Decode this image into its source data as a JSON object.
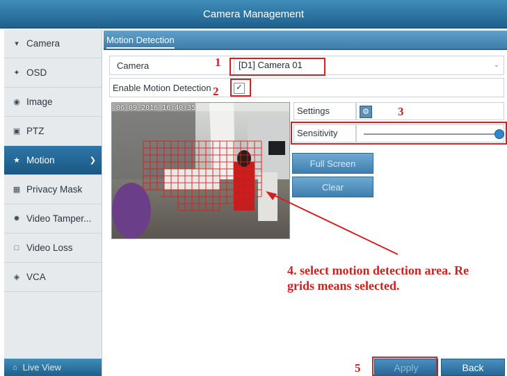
{
  "window": {
    "title": "Camera Management"
  },
  "sidebar": {
    "items": [
      {
        "label": "Camera",
        "icon": "camera-icon"
      },
      {
        "label": "OSD",
        "icon": "osd-icon"
      },
      {
        "label": "Image",
        "icon": "image-icon"
      },
      {
        "label": "PTZ",
        "icon": "ptz-icon"
      },
      {
        "label": "Motion",
        "icon": "motion-icon",
        "active": true
      },
      {
        "label": "Privacy Mask",
        "icon": "privacy-mask-icon"
      },
      {
        "label": "Video Tamper...",
        "icon": "video-tamper-icon"
      },
      {
        "label": "Video Loss",
        "icon": "video-loss-icon"
      },
      {
        "label": "VCA",
        "icon": "vca-icon"
      }
    ],
    "live_view": "Live View"
  },
  "main": {
    "tab": "Motion Detection",
    "camera_label": "Camera",
    "camera_value": "[D1] Camera 01",
    "enable_label": "Enable Motion Detection",
    "enable_checked": true,
    "preview_timestamp": "06-09-2016 16:40:35",
    "settings_label": "Settings",
    "sensitivity_label": "Sensitivity",
    "sensitivity_level": 1.0,
    "full_screen_label": "Full Screen",
    "clear_label": "Clear",
    "apply_label": "Apply",
    "back_label": "Back"
  },
  "annotations": {
    "n1": "1",
    "n2": "2",
    "n3": "3",
    "n5": "5",
    "note_line1": "4. select motion detection area. Re",
    "note_line2": "grids means selected.",
    "color": "#d42020"
  },
  "colors": {
    "header": "#2a6f9f",
    "active_item": "#2d77a8",
    "sidebar_bg": "#e6eaed",
    "annotation_red": "#d42020"
  }
}
